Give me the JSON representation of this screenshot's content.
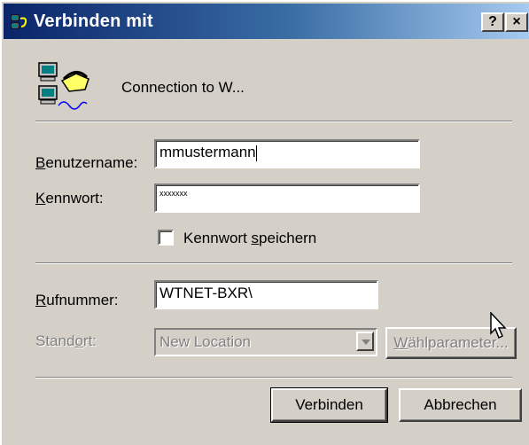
{
  "window": {
    "title": "Verbinden mit",
    "help_label": "?",
    "close_label": "×"
  },
  "connection": {
    "name": "Connection to W..."
  },
  "form": {
    "username_label_u": "B",
    "username_label_rest": "enutzername:",
    "username_value": "mmustermann",
    "password_label_u": "K",
    "password_label_rest": "ennwort:",
    "password_value": "xxxxxxx",
    "save_password_label_a": "Kennwort ",
    "save_password_label_u": "s",
    "save_password_label_b": "peichern",
    "save_password_checked": false,
    "phone_label_u": "R",
    "phone_label_rest": "ufnummer:",
    "phone_value": "WTNET-BXR\\",
    "location_label_a": "Stand",
    "location_label_u": "o",
    "location_label_b": "rt:",
    "location_value": "New Location",
    "dial_props_u": "W",
    "dial_props_rest": "ählparameter..."
  },
  "buttons": {
    "connect": "Verbinden",
    "cancel": "Abbrechen"
  },
  "icons": {
    "title": "network-computer-icon",
    "connection": "dial-up-connection-icon",
    "cursor": "mouse-pointer-icon"
  }
}
